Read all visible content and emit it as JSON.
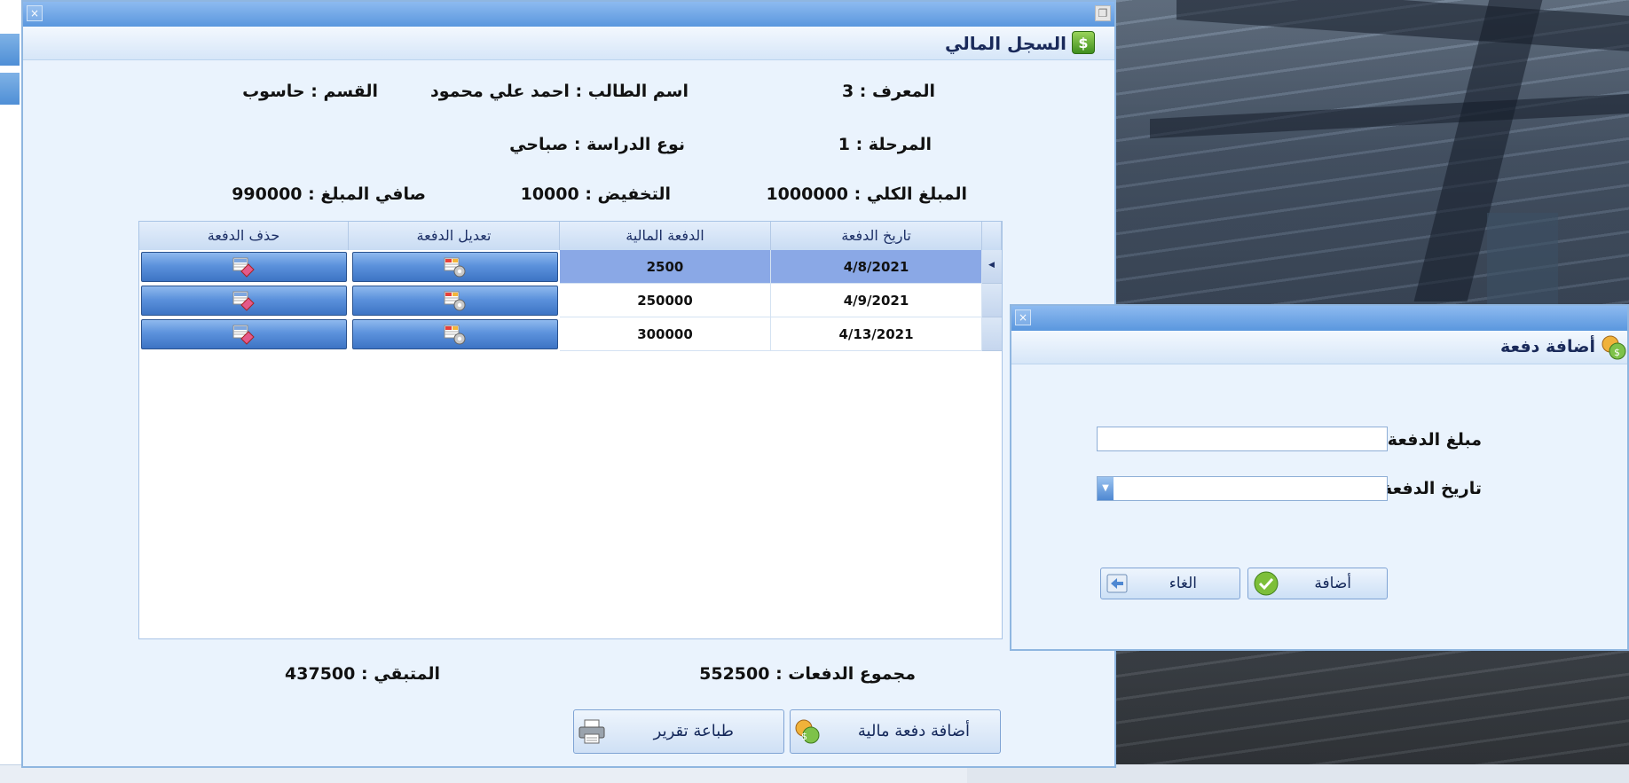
{
  "main_window": {
    "title": "السجل المالي",
    "icon": "money-icon",
    "info": {
      "id": "المعرف : 3",
      "student_name": "اسم الطالب : احمد علي محمود",
      "department": "القسم : حاسوب",
      "stage": "المرحلة : 1",
      "study_type": "نوع الدراسة : صباحي",
      "total_amount": "المبلغ الكلي : 1000000",
      "discount": "التخفيض : 10000",
      "net_amount": "صافي المبلغ : 990000"
    },
    "grid": {
      "columns": [
        "تاريخ الدفعة",
        "الدفعة المالية",
        "تعديل الدفعة",
        "حذف الدفعة"
      ],
      "rows": [
        {
          "date": "4/8/2021",
          "amount": "2500",
          "selected": true
        },
        {
          "date": "4/9/2021",
          "amount": "250000",
          "selected": false
        },
        {
          "date": "4/13/2021",
          "amount": "300000",
          "selected": false
        }
      ]
    },
    "totals": {
      "payments_sum": "مجموع الدفعات : 552500",
      "remaining": "المتبقي : 437500"
    },
    "buttons": {
      "add_payment": "أضافة دفعة مالية",
      "print_report": "طباعة تقرير"
    }
  },
  "dialog": {
    "title": "أضافة دفعة",
    "icon": "coins-icon",
    "amount_label": "مبلغ الدفعة :",
    "amount_value": "",
    "date_label": "تاريخ الدفعة :",
    "date_value": "",
    "add_button": "أضافة",
    "cancel_button": "الغاء"
  },
  "colors": {
    "window_bg": "#eaf3fd",
    "titlebar": "#5a97de",
    "grid_selected": "#8aa8e6",
    "grid_button": "#4f86d2"
  }
}
